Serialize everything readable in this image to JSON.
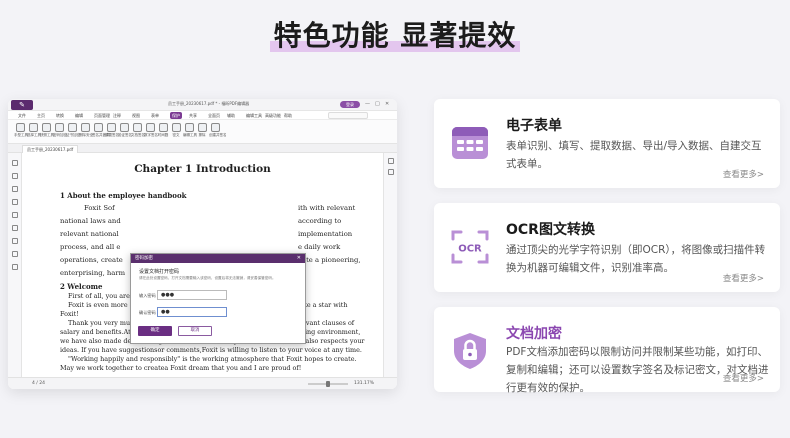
{
  "heading": "特色功能 显著提效",
  "app": {
    "logo": "",
    "window_title": "员工手册_20230617.pdf * - 福昕PDF编辑器",
    "sign_in": "登录",
    "window_controls": [
      "—",
      "□",
      "✕"
    ],
    "menus": [
      {
        "label": "文件",
        "active": false
      },
      {
        "label": "主页",
        "active": false
      },
      {
        "label": "转换",
        "active": false
      },
      {
        "label": "编辑",
        "active": false
      },
      {
        "label": "页面管理",
        "active": false
      },
      {
        "label": "注释",
        "active": false
      },
      {
        "label": "视图",
        "active": false
      },
      {
        "label": "表单",
        "active": false
      },
      {
        "label": "保护",
        "active": true
      },
      {
        "label": "共享",
        "active": false
      },
      {
        "label": "全面页",
        "active": false
      },
      {
        "label": "辅助",
        "active": false
      },
      {
        "label": "编辑工具",
        "active": false
      },
      {
        "label": "高级功能",
        "active": false
      },
      {
        "label": "帮助",
        "active": false
      }
    ],
    "tools": [
      "手型工具",
      "选择工具",
      "快照工具",
      "密码加密",
      "证书加密",
      "删除安全",
      "签名并盖章",
      "放置签名",
      "验证签名",
      "文档签名",
      "数字签名",
      "时间戳",
      "密文",
      "编辑工具",
      "擦除",
      "创建并签名"
    ],
    "doc_tab": "员工手册_20230617.pdf",
    "document": {
      "chapter": "Chapter 1 Introduction",
      "section1": "1    About the employee handbook",
      "para_lines": [
        "Foxit Sof",
        "national laws and",
        "relevant national",
        "process, and all e",
        "operations, create",
        "enterprising, harm"
      ],
      "para_right": [
        "ith with relevant",
        "according to",
        "implementation",
        "e daily work",
        "eate a pioneering,"
      ],
      "section2": "2    Welcome",
      "body_lines": [
        "First of all, you are welcome to become a member of Foxit Software!",
        "Foxit is even more eye-catching because of you, and you willalso shine like a star with",
        "Foxit!",
        "Thank you very much for your hard work, so we have formulated the relevant clauses of",
        "salary and benefits.At the same time, in order to create a comfortable working environment,",
        "we have also made detailed regulations on work discipline.Of course, Foxit also respects your",
        "ideas. If you have suggestionsor comments,Foxit is willing to listen to your voice at any time.",
        "\"Working happily and responsibly\" is the working atmosphere that Foxit hopes to create.",
        "May we work together to createa Foxit dream that you and I are proud of!"
      ]
    },
    "status": {
      "page": "4 / 24",
      "zoom": "131.17%"
    },
    "dialog": {
      "title": "密码加密",
      "close": "✕",
      "heading": "设置文档打开密码",
      "description": "请在此处设置密码，打开文档需要输入该密码，设置后将无法撤销，请妥善保管密码。",
      "password_label": "输入密码",
      "password_value": "●●●",
      "confirm_label": "确认密码",
      "confirm_value": "●●",
      "ok": "确定",
      "cancel": "取消"
    }
  },
  "features": [
    {
      "title": "电子表单",
      "desc": "表单识别、填写、提取数据、导出/导入数据、自建交互式表单。",
      "more": "查看更多>",
      "icon": "form-icon",
      "active": false
    },
    {
      "title": "OCR图文转换",
      "desc": "通过顶尖的光学字符识别（即OCR），将图像或扫描件转换为机器可编辑文件，识别准率高。",
      "more": "查看更多>",
      "icon": "ocr-icon",
      "active": false
    },
    {
      "title": "文档加密",
      "desc": "PDF文档添加密码以限制访问并限制某些功能，如打印、复制和编辑；还可以设置数字签名及标记密文，对文档进行更有效的保护。",
      "more": "查看更多>",
      "icon": "lock-icon",
      "active": true
    }
  ],
  "colors": {
    "accent": "#8b47b0",
    "dialog_title": "#5a2f6d",
    "icon_bg": "#b98fd6"
  }
}
